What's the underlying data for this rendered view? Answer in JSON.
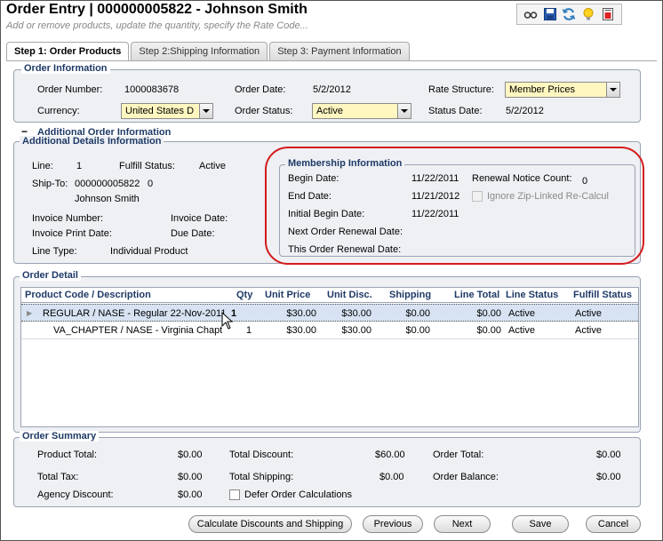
{
  "header": {
    "title": "Order Entry | 000000005822 - Johnson Smith",
    "subtitle": "Add or remove products, update the quantity, specify the Rate Code..."
  },
  "toolbar": {
    "icons": [
      "glasses-icon",
      "save-icon",
      "refresh-icon",
      "lightbulb-icon",
      "report-icon"
    ]
  },
  "tabs": [
    {
      "label": "Step 1: Order Products",
      "active": true
    },
    {
      "label": "Step 2:Shipping Information",
      "active": false
    },
    {
      "label": "Step 3: Payment Information",
      "active": false
    }
  ],
  "order_info": {
    "legend": "Order Information",
    "order_number_label": "Order Number:",
    "order_number": "1000083678",
    "order_date_label": "Order Date:",
    "order_date": "5/2/2012",
    "rate_structure_label": "Rate Structure:",
    "rate_structure": "Member Prices",
    "currency_label": "Currency:",
    "currency": "United States D",
    "order_status_label": "Order Status:",
    "order_status": "Active",
    "status_date_label": "Status Date:",
    "status_date": "5/2/2012"
  },
  "additional": {
    "toggle": "−",
    "outer_legend": "Additional Order Information",
    "legend": "Additional Details Information",
    "line_label": "Line:",
    "line": "1",
    "fulfill_status_label": "Fulfill Status:",
    "fulfill_status": "Active",
    "ship_to_label": "Ship-To:",
    "ship_to_id": "000000005822",
    "ship_to_num": "0",
    "ship_to_name": "Johnson Smith",
    "invoice_number_label": "Invoice Number:",
    "invoice_date_label": "Invoice Date:",
    "invoice_print_date_label": "Invoice Print Date:",
    "due_date_label": "Due Date:",
    "line_type_label": "Line Type:",
    "line_type": "Individual Product"
  },
  "membership": {
    "legend": "Membership Information",
    "begin_date_label": "Begin Date:",
    "begin_date": "11/22/2011",
    "renewal_notice_label": "Renewal Notice Count:",
    "renewal_notice": "0",
    "end_date_label": "End Date:",
    "end_date": "11/21/2012",
    "ignore_zip_label": "Ignore Zip-Linked Re-Calcul",
    "initial_begin_label": "Initial Begin Date:",
    "initial_begin": "11/22/2011",
    "next_renewal_label": "Next Order Renewal Date:",
    "this_renewal_label": "This Order Renewal Date:"
  },
  "order_detail": {
    "legend": "Order Detail",
    "columns": [
      "Product Code / Description",
      "Qty",
      "Unit Price",
      "Unit Disc.",
      "Shipping",
      "Line Total",
      "Line Status",
      "Fulfill Status"
    ],
    "rows": [
      {
        "product": "REGULAR / NASE - Regular 22-Nov-2011",
        "qty": "1",
        "unit_price": "$30.00",
        "unit_disc": "$30.00",
        "shipping": "$0.00",
        "line_total": "$0.00",
        "line_status": "Active",
        "fulfill_status": "Active"
      },
      {
        "product": "VA_CHAPTER / NASE - Virginia Chapter",
        "qty": "1",
        "unit_price": "$30.00",
        "unit_disc": "$30.00",
        "shipping": "$0.00",
        "line_total": "$0.00",
        "line_status": "Active",
        "fulfill_status": "Active"
      }
    ]
  },
  "summary": {
    "legend": "Order Summary",
    "product_total_label": "Product Total:",
    "product_total": "$0.00",
    "total_discount_label": "Total Discount:",
    "total_discount": "$60.00",
    "order_total_label": "Order Total:",
    "order_total": "$0.00",
    "total_tax_label": "Total Tax:",
    "total_tax": "$0.00",
    "total_shipping_label": "Total Shipping:",
    "total_shipping": "$0.00",
    "order_balance_label": "Order Balance:",
    "order_balance": "$0.00",
    "agency_discount_label": "Agency Discount:",
    "agency_discount": "$0.00",
    "defer_label": "Defer Order Calculations"
  },
  "buttons": {
    "calculate": "Calculate Discounts and Shipping",
    "previous": "Previous",
    "next": "Next",
    "save": "Save",
    "cancel": "Cancel"
  },
  "colors": {
    "highlight_circle": "#d41a1a",
    "legend_text": "#1f3a66",
    "required_field": "#fff6c0"
  }
}
